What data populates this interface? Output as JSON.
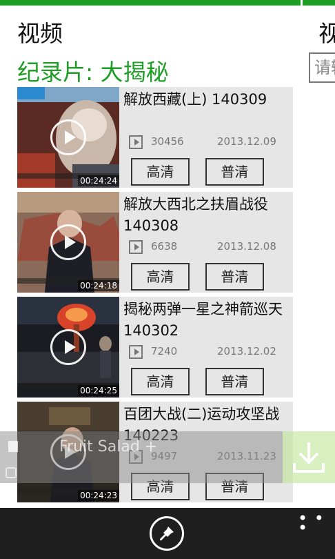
{
  "page": {
    "title": "视频",
    "next_title": "视",
    "subtitle": "纪录片: 大揭秘",
    "search_placeholder": "请输"
  },
  "videos": [
    {
      "title": "解放西藏(上) 140309",
      "plays": "30456",
      "date": "2013.12.09",
      "duration": "00:24:24",
      "hd_label": "高清",
      "sd_label": "普清"
    },
    {
      "title": "解放大西北之扶眉战役 140308",
      "plays": "6638",
      "date": "2013.12.08",
      "duration": "00:24:18",
      "hd_label": "高清",
      "sd_label": "普清"
    },
    {
      "title": "揭秘两弹一星之神箭巡天 140302",
      "plays": "7240",
      "date": "2013.12.02",
      "duration": "00:24:25",
      "hd_label": "高清",
      "sd_label": "普清"
    },
    {
      "title": "百团大战(二)运动攻坚战 140223",
      "plays": "9497",
      "date": "2013.11.23",
      "duration": "00:24:23",
      "hd_label": "高清",
      "sd_label": "普清"
    }
  ],
  "toast": {
    "text": "Fruit Salad +"
  },
  "icons": {
    "play": "play-circle-icon",
    "plays_count": "play-square-icon",
    "download": "download-icon",
    "pin": "pin-icon",
    "more": "ellipsis-icon"
  },
  "colors": {
    "accent": "#1f9e26",
    "list_bg": "#e6e6e6",
    "appbar": "#1f1f1f",
    "download_tile": "#bee496"
  }
}
